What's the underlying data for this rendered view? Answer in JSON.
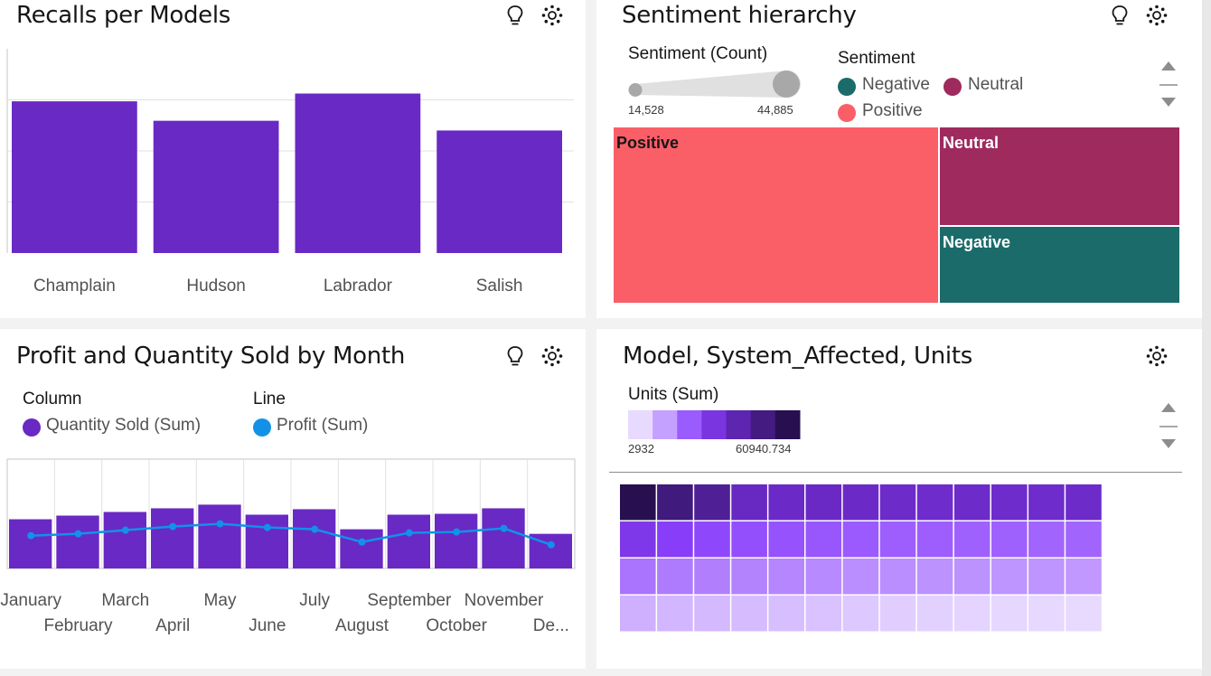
{
  "panels": {
    "recalls": {
      "title": "Recalls per Models"
    },
    "sentiment": {
      "title": "Sentiment hierarchy",
      "size_legend_title": "Sentiment (Count)",
      "size_min": "14,528",
      "size_max": "44,885",
      "color_legend_title": "Sentiment",
      "legend": [
        {
          "label": "Negative",
          "color": "#1b6b6b"
        },
        {
          "label": "Neutral",
          "color": "#9e2a5e"
        },
        {
          "label": "Positive",
          "color": "#fa5f68"
        }
      ]
    },
    "profit": {
      "title": "Profit and Quantity Sold by Month",
      "legend_column_title": "Column",
      "legend_column_item": "Quantity Sold (Sum)",
      "legend_line_title": "Line",
      "legend_line_item": "Profit (Sum)",
      "column_color": "#6929c4",
      "line_color": "#1192e8"
    },
    "heatmap": {
      "title": "Model, System_Affected, Units",
      "legend_title": "Units (Sum)",
      "legend_min": "2932",
      "legend_max": "60940.734"
    }
  },
  "chart_data": [
    {
      "id": "recalls",
      "type": "bar",
      "categories": [
        "Champlain",
        "Hudson",
        "Labrador",
        "Salish"
      ],
      "values": [
        78,
        68,
        82,
        63
      ],
      "ylim": [
        0,
        105
      ],
      "color": "#6929c4",
      "grid": true
    },
    {
      "id": "sentiment",
      "type": "treemap",
      "items": [
        {
          "label": "Positive",
          "value": 44885,
          "color": "#fa5f68"
        },
        {
          "label": "Neutral",
          "value": 18700,
          "color": "#9e2a5e"
        },
        {
          "label": "Negative",
          "value": 14528,
          "color": "#1b6b6b"
        }
      ]
    },
    {
      "id": "profit",
      "type": "bar",
      "categories": [
        "January",
        "February",
        "March",
        "April",
        "May",
        "June",
        "July",
        "August",
        "September",
        "October",
        "November",
        "December"
      ],
      "category_labels": [
        "January",
        "February",
        "March",
        "April",
        "May",
        "June",
        "July",
        "August",
        "September",
        "October",
        "November",
        "De..."
      ],
      "series": [
        {
          "name": "Quantity Sold (Sum)",
          "kind": "column",
          "values": [
            54,
            58,
            62,
            66,
            70,
            59,
            65,
            43,
            59,
            60,
            66,
            38
          ]
        },
        {
          "name": "Profit (Sum)",
          "kind": "line",
          "values": [
            36,
            38,
            42,
            46,
            49,
            45,
            43,
            29,
            39,
            40,
            44,
            26
          ]
        }
      ],
      "ylim": [
        0,
        120
      ],
      "grid": true
    },
    {
      "id": "heatmap",
      "type": "heatmap",
      "rows": 4,
      "cols": 13,
      "value_range": [
        2932,
        60940.734
      ],
      "values": [
        [
          60940,
          52000,
          47000,
          38000,
          37000,
          37500,
          37000,
          36500,
          36000,
          36500,
          36000,
          36000,
          36500
        ],
        [
          30000,
          27000,
          25000,
          24000,
          23500,
          23000,
          22500,
          22000,
          22000,
          21500,
          21500,
          21000,
          21000
        ],
        [
          19000,
          18000,
          17500,
          17000,
          16500,
          16000,
          15500,
          15500,
          15000,
          15000,
          14500,
          14500,
          14000
        ],
        [
          10000,
          9000,
          8500,
          8000,
          7500,
          7000,
          6000,
          5000,
          4500,
          4000,
          3500,
          3200,
          2932
        ]
      ]
    }
  ]
}
